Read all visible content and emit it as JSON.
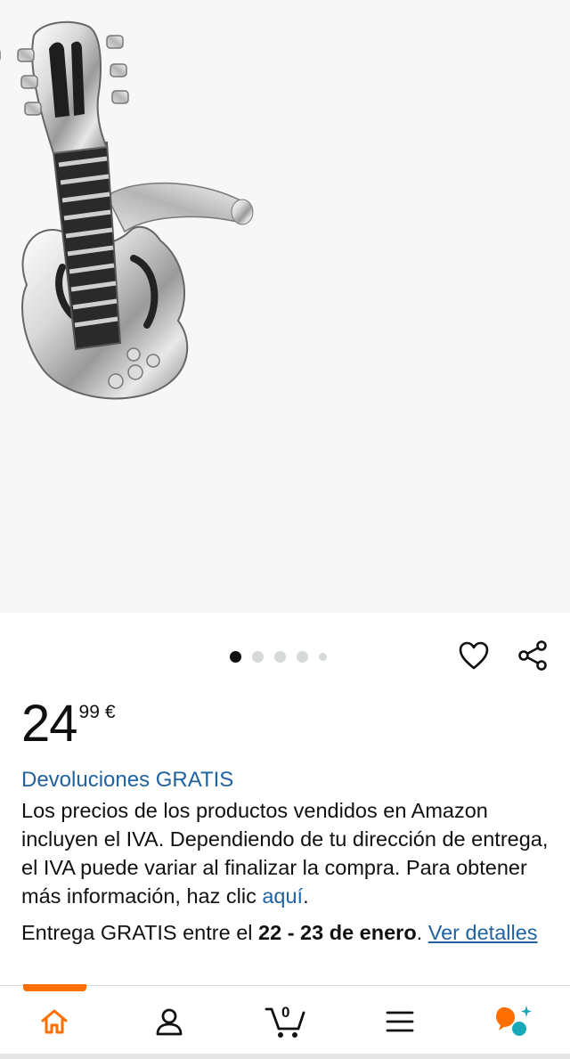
{
  "gallery": {
    "image_alt": "Gemelos en forma de guitarra eléctrica",
    "image_count": 5,
    "active_index": 0
  },
  "actions": {
    "favorite_icon": "heart-icon",
    "share_icon": "share-icon"
  },
  "price": {
    "whole": "24",
    "fraction": "99",
    "currency": "€"
  },
  "returns_label": "Devoluciones GRATIS",
  "tax_note": {
    "text": "Los precios de los productos vendidos en Amazon incluyen el IVA. Dependiendo de tu dirección de entrega, el IVA puede variar al finalizar la compra. Para obtener más información, haz clic ",
    "link": "aquí",
    "end": "."
  },
  "delivery": {
    "prefix": "Entrega GRATIS entre el ",
    "dates": "22 - 23 de enero",
    "suffix": ". ",
    "link": "Ver detalles"
  },
  "bottom_nav": {
    "items": [
      {
        "name": "home",
        "icon": "home-icon",
        "active": true
      },
      {
        "name": "account",
        "icon": "person-icon"
      },
      {
        "name": "cart",
        "icon": "cart-icon",
        "count": "0"
      },
      {
        "name": "menu",
        "icon": "menu-icon"
      },
      {
        "name": "rufus",
        "icon": "assistant-icon"
      }
    ]
  },
  "colors": {
    "link": "#2162a1",
    "accent": "#ff6f00",
    "text": "#0f1111",
    "assistant_teal": "#1aa7b8"
  }
}
